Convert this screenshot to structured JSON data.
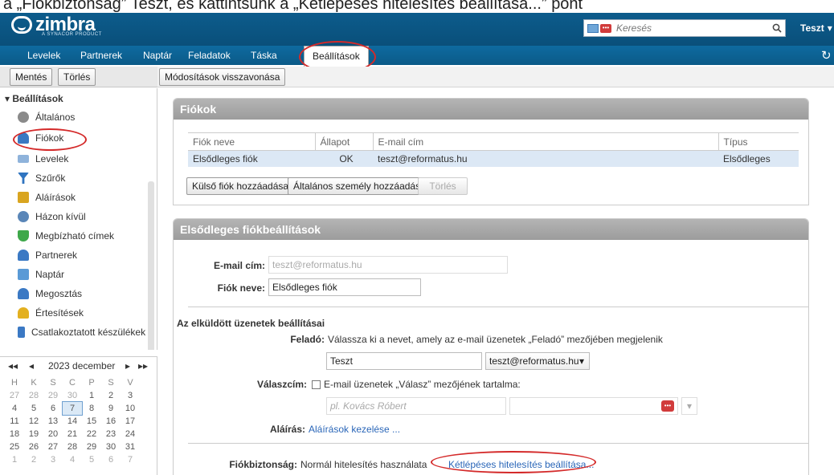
{
  "doc_caption": "a „Fiókbiztonság” Teszt, és kattintsunk a „Kétlépéses hitelesítés beállítása...” pont",
  "app": {
    "logo_word": "zimbra",
    "logo_sub": "A SYNACOR PRODUCT",
    "search_placeholder": "Keresés",
    "user_name": "Teszt"
  },
  "tabs": [
    {
      "label": "Levelek"
    },
    {
      "label": "Partnerek"
    },
    {
      "label": "Naptár"
    },
    {
      "label": "Feladatok"
    },
    {
      "label": "Táska"
    },
    {
      "label": "Beállítások"
    }
  ],
  "left_toolbar": {
    "save": "Mentés",
    "delete": "Törlés"
  },
  "right_toolbar": {
    "undo": "Módosítások visszavonása"
  },
  "tree": {
    "heading": "Beállítások",
    "items": [
      {
        "label": "Általános",
        "icon": "gear-icon",
        "color": "#8a8a8a"
      },
      {
        "label": "Fiókok",
        "icon": "accounts-icon",
        "color": "#3a78c2"
      },
      {
        "label": "Levelek",
        "icon": "mail-icon",
        "color": "#8fb3db"
      },
      {
        "label": "Szűrők",
        "icon": "filter-icon",
        "color": "#2f74c0"
      },
      {
        "label": "Aláírások",
        "icon": "signature-icon",
        "color": "#d9a520"
      },
      {
        "label": "Házon kívül",
        "icon": "away-icon",
        "color": "#5a86b8"
      },
      {
        "label": "Megbízható címek",
        "icon": "shield-check-icon",
        "color": "#3ea84a"
      },
      {
        "label": "Partnerek",
        "icon": "contact-icon",
        "color": "#3b79c4"
      },
      {
        "label": "Naptár",
        "icon": "calendar-icon",
        "color": "#5a9ad6"
      },
      {
        "label": "Megosztás",
        "icon": "share-icon",
        "color": "#3b79c4"
      },
      {
        "label": "Értesítések",
        "icon": "bell-icon",
        "color": "#e3b020"
      },
      {
        "label": "Csatlakoztatott készülékek",
        "icon": "device-icon",
        "color": "#3b79c4"
      }
    ]
  },
  "calendar": {
    "title": "2023 december",
    "dow": [
      "H",
      "K",
      "Sz",
      "Cs",
      "P",
      "Sz",
      "V"
    ],
    "dow_display": [
      "H",
      "K",
      "S",
      "C",
      "P",
      "S",
      "V"
    ],
    "weeks": [
      [
        "27",
        "28",
        "29",
        "30",
        "1",
        "2",
        "3"
      ],
      [
        "4",
        "5",
        "6",
        "7",
        "8",
        "9",
        "10"
      ],
      [
        "11",
        "12",
        "13",
        "14",
        "15",
        "16",
        "17"
      ],
      [
        "18",
        "19",
        "20",
        "21",
        "22",
        "23",
        "24"
      ],
      [
        "25",
        "26",
        "27",
        "28",
        "29",
        "30",
        "31"
      ],
      [
        "1",
        "2",
        "3",
        "4",
        "5",
        "6",
        "7"
      ]
    ],
    "today": "7"
  },
  "accounts_panel": {
    "title": "Fiókok",
    "columns": [
      "Fiók neve",
      "Állapot",
      "E-mail cím",
      "Típus"
    ],
    "rows": [
      [
        "Elsődleges fiók",
        "OK",
        "teszt@reformatus.hu",
        "Elsődleges"
      ]
    ],
    "add_external": "Külső fiók hozzáadása",
    "add_persona": "Általános személy hozzáadása",
    "delete": "Törlés"
  },
  "primary_panel": {
    "title": "Elsődleges fiókbeállítások",
    "email_label": "E-mail cím:",
    "email_value": "teszt@reformatus.hu",
    "name_label": "Fiók neve:",
    "name_value": "Elsődleges fiók",
    "sent_heading": "Az elküldött üzenetek beállításai",
    "from_label": "Feladó:",
    "from_hint": "Válassza ki a nevet, amely az e-mail üzenetek „Feladó” mezőjében megjelenik",
    "from_name": "Teszt",
    "from_address": "teszt@reformatus.hu",
    "reply_label": "Válaszcím:",
    "reply_hint": "E-mail üzenetek „Válasz” mezőjének tartalma:",
    "reply_placeholder": "pl. Kovács Róbert",
    "signature_label": "Aláírás:",
    "signature_link": "Aláírások kezelése ...",
    "security_label": "Fiókbiztonság:",
    "security_value": "Normál hitelesítés használata",
    "security_link": "Kétlépéses hitelesítés beállítása..."
  }
}
